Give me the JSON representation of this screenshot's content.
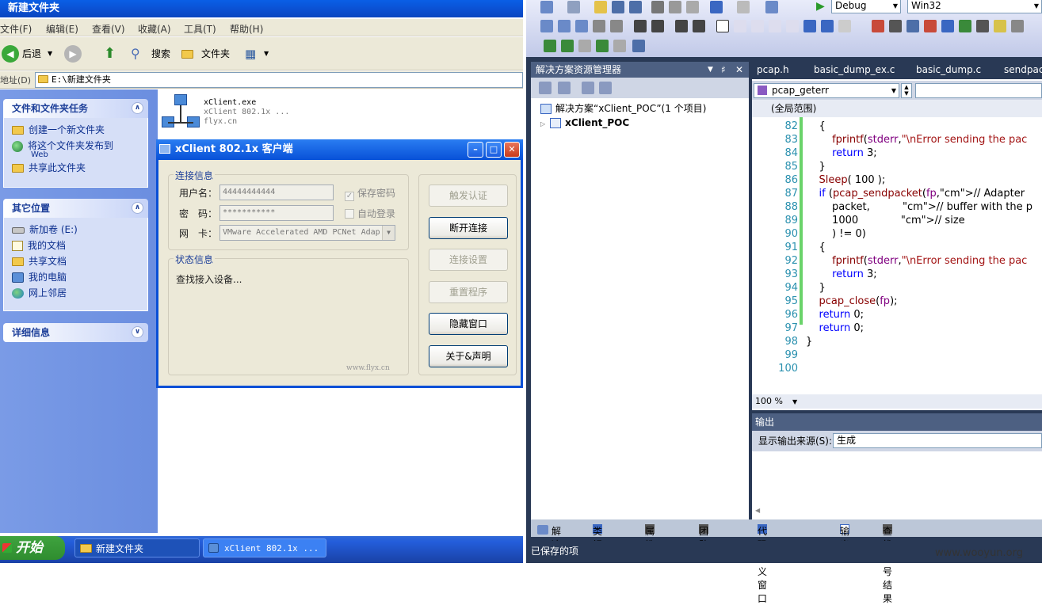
{
  "explorer": {
    "title": "新建文件夹",
    "menu": [
      "文件(F)",
      "编辑(E)",
      "查看(V)",
      "收藏(A)",
      "工具(T)",
      "帮助(H)"
    ],
    "back_label": "后退",
    "search_label": "搜索",
    "folders_label": "文件夹",
    "address_label": "地址(D)",
    "address_value": "E:\\新建文件夹",
    "tasks_title": "文件和文件夹任务",
    "tasks": [
      "创建一个新文件夹",
      "将这个文件夹发布到",
      "Web",
      "共享此文件夹"
    ],
    "places_title": "其它位置",
    "places": [
      "新加卷 (E:)",
      "我的文档",
      "共享文档",
      "我的电脑",
      "网上邻居"
    ],
    "details_title": "详细信息",
    "file": {
      "name": "xClient.exe",
      "desc": "xClient 802.1x ...",
      "company": "flyx.cn"
    }
  },
  "dialog": {
    "title": "xClient 802.1x 客户端",
    "conn_group": "连接信息",
    "username_label": "用户名：",
    "username_value": "44444444444",
    "password_label": "密　码：",
    "password_value": "***********",
    "nic_label": "网　卡：",
    "nic_value": "VMware Accelerated AMD PCNet Adap",
    "save_pw": "保存密码",
    "auto_login": "自动登录",
    "status_group": "状态信息",
    "status_text": "查找接入设备...",
    "watermark": "www.flyx.cn",
    "buttons": [
      "触发认证",
      "断开连接",
      "连接设置",
      "重置程序",
      "隐藏窗口",
      "关于&声明"
    ]
  },
  "taskbar": {
    "start": "开始",
    "tasks": [
      "新建文件夹",
      "xClient 802.1x ..."
    ]
  },
  "vs": {
    "config": "Debug",
    "platform": "Win32",
    "solution_explorer_title": "解决方案资源管理器",
    "solution_label": "解决方案“xClient_POC”(1 个项目)",
    "project": "xClient_POC",
    "tabs": [
      "pcap.h",
      "basic_dump_ex.c",
      "basic_dump.c",
      "sendpac"
    ],
    "function_combo": "pcap_geterr",
    "scope": "(全局范围)",
    "zoom": "100 %",
    "output_title": "输出",
    "output_source_label": "显示输出来源(S):",
    "output_source_value": "生成",
    "bottom_tabs": [
      "解决...",
      "类视图",
      "属性...",
      "团队...",
      "代码定义窗口",
      "输出",
      "查找符号结果"
    ],
    "status": "已保存的项",
    "code_lines": [
      {
        "n": "82",
        "t": "    {"
      },
      {
        "n": "83",
        "t": "        fprintf(stderr,\"\\nError sending the pac"
      },
      {
        "n": "84",
        "t": "        return 3;"
      },
      {
        "n": "85",
        "t": "    }"
      },
      {
        "n": "86",
        "t": "    Sleep( 100 );"
      },
      {
        "n": "87",
        "t": "    if (pcap_sendpacket(fp,// Adapter"
      },
      {
        "n": "88",
        "t": "        packet,          // buffer with the p"
      },
      {
        "n": "89",
        "t": "        1000             // size"
      },
      {
        "n": "90",
        "t": "        ) != 0)"
      },
      {
        "n": "91",
        "t": "    {"
      },
      {
        "n": "92",
        "t": "        fprintf(stderr,\"\\nError sending the pac"
      },
      {
        "n": "93",
        "t": "        return 3;"
      },
      {
        "n": "94",
        "t": "    }"
      },
      {
        "n": "95",
        "t": "    pcap_close(fp);"
      },
      {
        "n": "96",
        "t": "    return 0;"
      },
      {
        "n": "97",
        "t": "    return 0;"
      },
      {
        "n": "98",
        "t": "}"
      },
      {
        "n": "99",
        "t": ""
      },
      {
        "n": "100",
        "t": ""
      }
    ]
  },
  "watermark": "www.wooyun.org"
}
